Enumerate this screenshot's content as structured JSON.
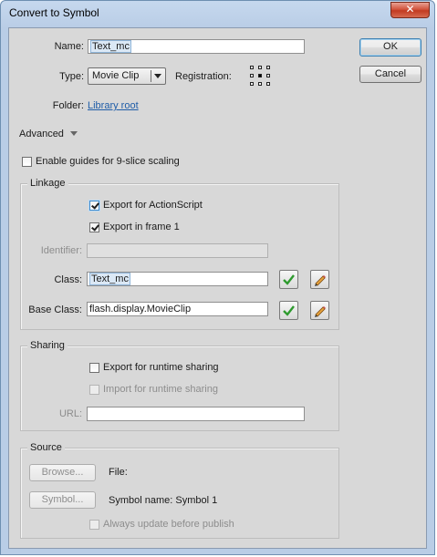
{
  "window": {
    "title": "Convert to Symbol",
    "close_symbol": "✕"
  },
  "name": {
    "label": "Name:",
    "value": "Text_mc"
  },
  "type": {
    "label": "Type:",
    "selected": "Movie Clip"
  },
  "registration": {
    "label": "Registration:",
    "selected_point": "center"
  },
  "folder": {
    "label": "Folder:",
    "link": "Library root"
  },
  "buttons": {
    "ok": "OK",
    "cancel": "Cancel"
  },
  "advanced": {
    "label": "Advanced"
  },
  "nine_slice": {
    "label": "Enable guides for 9-slice scaling",
    "checked": false
  },
  "linkage": {
    "title": "Linkage",
    "export_actionscript": {
      "label": "Export for ActionScript",
      "checked": true
    },
    "export_frame1": {
      "label": "Export in frame 1",
      "checked": true
    },
    "identifier": {
      "label": "Identifier:",
      "value": ""
    },
    "class": {
      "label": "Class:",
      "value": "Text_mc"
    },
    "base_class": {
      "label": "Base Class:",
      "value": "flash.display.MovieClip"
    }
  },
  "sharing": {
    "title": "Sharing",
    "export_runtime": {
      "label": "Export for runtime sharing",
      "checked": false
    },
    "import_runtime": {
      "label": "Import for runtime sharing",
      "checked": false,
      "disabled": true
    },
    "url": {
      "label": "URL:",
      "value": ""
    }
  },
  "source": {
    "title": "Source",
    "browse_button": "Browse...",
    "file_label": "File:",
    "symbol_button": "Symbol...",
    "symbol_name": "Symbol name: Symbol 1",
    "always_update": {
      "label": "Always update before publish",
      "checked": false,
      "disabled": true
    }
  },
  "icons": {
    "validate": "checkmark-icon",
    "edit": "pencil-icon",
    "close": "close-icon",
    "registration": "registration-grid-icon",
    "expand": "triangle-down-icon"
  },
  "colors": {
    "title_bar": "#b9cde6",
    "dialog_bg": "#d8d8d8",
    "close_button": "#c23b22",
    "link": "#1f5da8",
    "check_green": "#2e9a2e"
  }
}
